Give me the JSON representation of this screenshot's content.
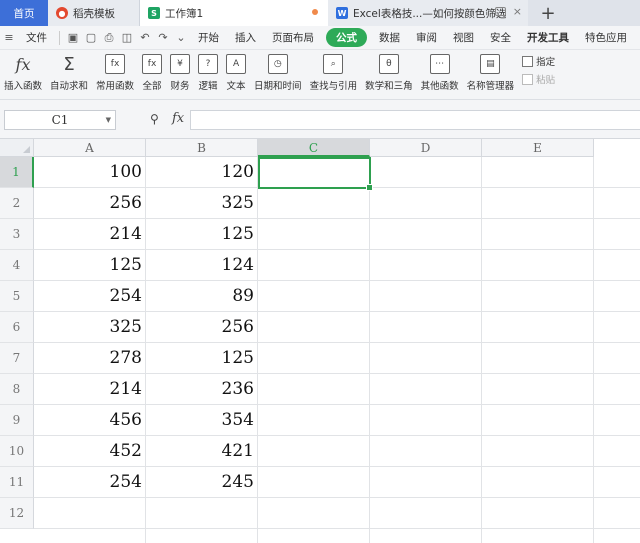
{
  "tabs": [
    {
      "label": "首页"
    },
    {
      "label": "稻壳模板",
      "icon": "docer-icon"
    },
    {
      "label": "工作簿1",
      "icon": "spreadsheet-icon"
    },
    {
      "label": "Excel表格技...—如何按颜色筛选",
      "icon": "word-icon"
    }
  ],
  "tab_plus": "+",
  "menu": {
    "file": "文件",
    "items": [
      "开始",
      "插入",
      "页面布局",
      "公式",
      "数据",
      "审阅",
      "视图",
      "安全",
      "开发工具",
      "特色应用"
    ],
    "active": "公式"
  },
  "ribbon": {
    "buttons": [
      {
        "label": "插入函数",
        "icon": "fx"
      },
      {
        "label": "自动求和",
        "icon": "Σ"
      },
      {
        "label": "常用函数",
        "icon": "fx"
      },
      {
        "label": "全部",
        "icon": "fx"
      },
      {
        "label": "财务",
        "icon": "¥"
      },
      {
        "label": "逻辑",
        "icon": "?"
      },
      {
        "label": "文本",
        "icon": "A"
      },
      {
        "label": "日期和时间",
        "icon": "◷"
      },
      {
        "label": "查找与引用",
        "icon": "⌕"
      },
      {
        "label": "数学和三角",
        "icon": "θ"
      },
      {
        "label": "其他函数",
        "icon": "⋯"
      },
      {
        "label": "名称管理器",
        "icon": "▤"
      }
    ],
    "right": [
      {
        "label": "指定",
        "disabled": false
      },
      {
        "label": "粘贴",
        "disabled": true
      }
    ]
  },
  "formula_bar": {
    "name_box": "C1",
    "fx": "fx",
    "value": ""
  },
  "grid": {
    "columns": [
      "A",
      "B",
      "C",
      "D",
      "E"
    ],
    "active_column": "C",
    "rows": [
      "1",
      "2",
      "3",
      "4",
      "5",
      "6",
      "7",
      "8",
      "9",
      "10",
      "11",
      "12"
    ],
    "active_row": "1",
    "data": [
      [
        "100",
        "120"
      ],
      [
        "256",
        "325"
      ],
      [
        "214",
        "125"
      ],
      [
        "125",
        "124"
      ],
      [
        "254",
        "89"
      ],
      [
        "325",
        "256"
      ],
      [
        "278",
        "125"
      ],
      [
        "214",
        "236"
      ],
      [
        "456",
        "354"
      ],
      [
        "452",
        "421"
      ],
      [
        "254",
        "245"
      ]
    ]
  },
  "colors": {
    "accent": "#2ea04f",
    "home_tab": "#3d6fd8"
  }
}
